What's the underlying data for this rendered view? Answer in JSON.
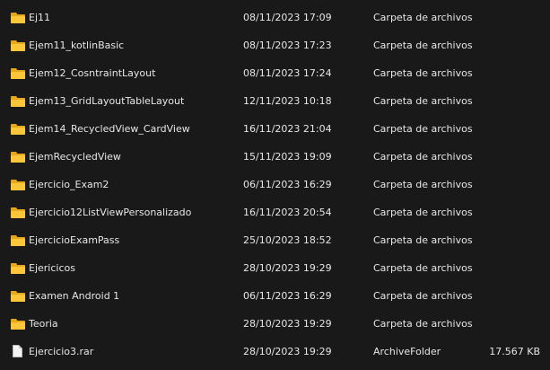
{
  "rows": [
    {
      "name": "Ej11",
      "date": "08/11/2023 17:09",
      "type": "Carpeta de archivos",
      "size": "",
      "icon": "folder-icon"
    },
    {
      "name": "Ejem11_kotlinBasic",
      "date": "08/11/2023 17:23",
      "type": "Carpeta de archivos",
      "size": "",
      "icon": "folder-icon"
    },
    {
      "name": "Ejem12_CosntraintLayout",
      "date": "08/11/2023 17:24",
      "type": "Carpeta de archivos",
      "size": "",
      "icon": "folder-icon"
    },
    {
      "name": "Ejem13_GridLayoutTableLayout",
      "date": "12/11/2023 10:18",
      "type": "Carpeta de archivos",
      "size": "",
      "icon": "folder-icon"
    },
    {
      "name": "Ejem14_RecycledView_CardView",
      "date": "16/11/2023 21:04",
      "type": "Carpeta de archivos",
      "size": "",
      "icon": "folder-icon"
    },
    {
      "name": "EjemRecycledView",
      "date": "15/11/2023 19:09",
      "type": "Carpeta de archivos",
      "size": "",
      "icon": "folder-icon"
    },
    {
      "name": "Ejercicio_Exam2",
      "date": "06/11/2023 16:29",
      "type": "Carpeta de archivos",
      "size": "",
      "icon": "folder-icon"
    },
    {
      "name": "Ejercicio12ListViewPersonalizado",
      "date": "16/11/2023 20:54",
      "type": "Carpeta de archivos",
      "size": "",
      "icon": "folder-icon"
    },
    {
      "name": "EjercicioExamPass",
      "date": "25/10/2023 18:52",
      "type": "Carpeta de archivos",
      "size": "",
      "icon": "folder-icon"
    },
    {
      "name": "Ejericicos",
      "date": "28/10/2023 19:29",
      "type": "Carpeta de archivos",
      "size": "",
      "icon": "folder-icon"
    },
    {
      "name": "Examen Android 1",
      "date": "06/11/2023 16:29",
      "type": "Carpeta de archivos",
      "size": "",
      "icon": "folder-icon"
    },
    {
      "name": "Teoria",
      "date": "28/10/2023 19:29",
      "type": "Carpeta de archivos",
      "size": "",
      "icon": "folder-icon"
    },
    {
      "name": "Ejercicio3.rar",
      "date": "28/10/2023 19:29",
      "type": "ArchiveFolder",
      "size": "17.567 KB",
      "icon": "archive-file-icon"
    }
  ],
  "colors": {
    "background": "#191919",
    "text": "#e6e6e6",
    "folder": "#fcc63a"
  }
}
